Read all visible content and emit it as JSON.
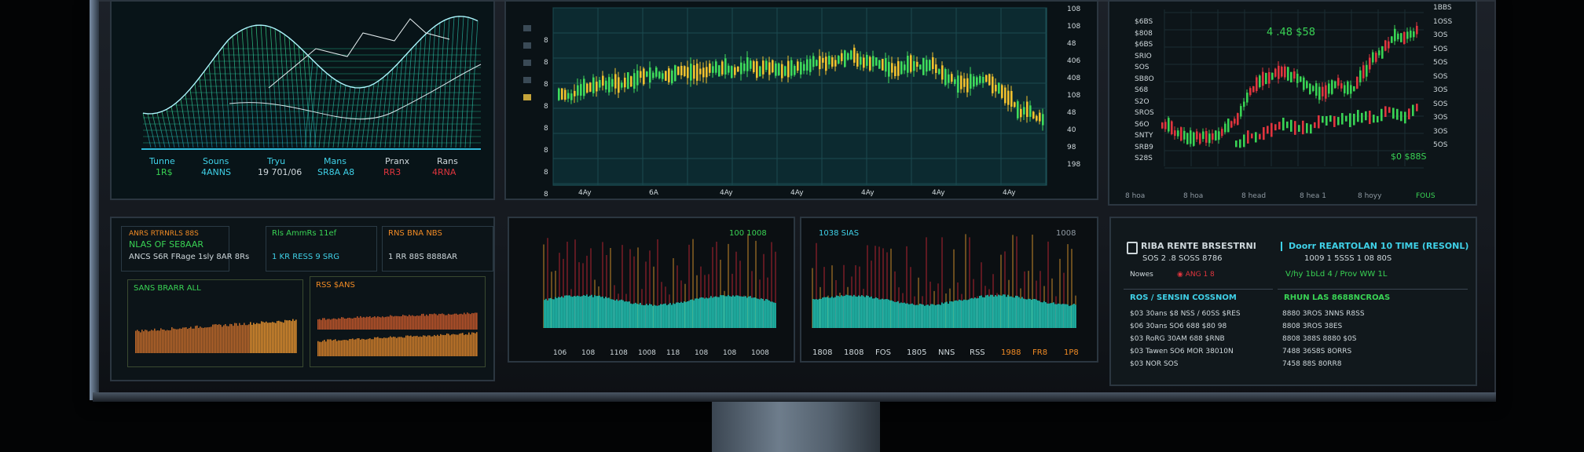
{
  "colors": {
    "cyan": "#3fd1e8",
    "green": "#39d354",
    "red": "#e0353e",
    "yellow": "#f2c12e",
    "orange": "#f08a24",
    "teal": "#2aa5a8"
  },
  "panel1": {
    "labels": [
      "Tunne",
      "Souns",
      "Tryu",
      "Mans",
      "Pranx",
      "Rans"
    ],
    "values": [
      "1R$",
      "4ANNS",
      "19 701/06",
      "SR8A A8",
      "RR3",
      "4RNA"
    ]
  },
  "panel2": {
    "y_ticks": [
      "8",
      "8",
      "8",
      "8",
      "8",
      "8",
      "8",
      "8"
    ],
    "right_ticks": [
      "108",
      "108",
      "48",
      "406",
      "408",
      "108",
      "48",
      "40",
      "98",
      "198"
    ],
    "x_ticks": [
      "4Ay",
      "6A",
      "4Ay",
      "4Ay",
      "4Ay",
      "4Ay",
      "4Ay"
    ]
  },
  "panel3": {
    "header": "4 .48 $58",
    "left_labels": [
      "$6BS",
      "$808",
      "$6BS",
      "SRIO",
      "SOS",
      "SB8O",
      "S68",
      "S2O",
      "SROS",
      "S6O",
      "SNTY",
      "SRB9",
      "S28S"
    ],
    "right_labels": [
      "1BBS",
      "1OSS",
      "3OS",
      "5OS",
      "5OS",
      "SOS",
      "3OS",
      "SOS",
      "3OS",
      "3OS",
      "5OS"
    ],
    "bottom_labels": [
      "8 hoa",
      "8 hoa",
      "8 head",
      "8 hea 1",
      "8 hoyy",
      "FOUS"
    ],
    "mid_label": "$0 $88S"
  },
  "panel4": {
    "title": "NLAS OF SE8AAR",
    "rows": [
      "ANCS  S6R  FRage  1sly 8AR 8Rs",
      "Rls AmmRs  11ef",
      "1 KR  RESS 9  SRG"
    ],
    "sub_labels": [
      "SANS BRARR  ALL",
      "RSS   $ANS"
    ]
  },
  "panel5": {
    "header": "100  1008",
    "x_ticks": [
      "106",
      "108",
      "1108",
      "1008",
      "118",
      "108",
      "108",
      "1008"
    ]
  },
  "panel6": {
    "header": "1038 SIAS",
    "header_right": "1008",
    "x_ticks": [
      "1808",
      "1808",
      "FOS",
      "1805",
      "NNS",
      "RSS",
      "1988",
      "FR8",
      "1P8"
    ]
  },
  "panel7": {
    "title_left": "RIBA  RENTE  BRSESTRNI",
    "title_right": "Doorr  REARTOLAN  10  TIME  (RESONL)",
    "line2_left": "SOS 2 .8  SOSS  8786",
    "line2_right": "1009 1 5SSS 1 08 80S",
    "section_left": "ROS / SENSIN COSSNOM",
    "section_right": "RHUN  LAS  8688NCROAS",
    "rows": [
      "$03 30ans  $8 NSS / 60SS  $RES",
      "$06 30ans  SO6 688  $80 98",
      "$03 RoRG  30AM 688 $RNB",
      "$03 Tawen  SO6 MOR 38010N",
      "$03 NOR SOS"
    ],
    "rows_right": [
      "8880 3ROS 3NNS R8SS",
      "8808 3ROS 38ES",
      "8808 388S 8880 $0S",
      "7488 36S8S 8ORRS",
      "7458 88S 80RR8"
    ]
  }
}
